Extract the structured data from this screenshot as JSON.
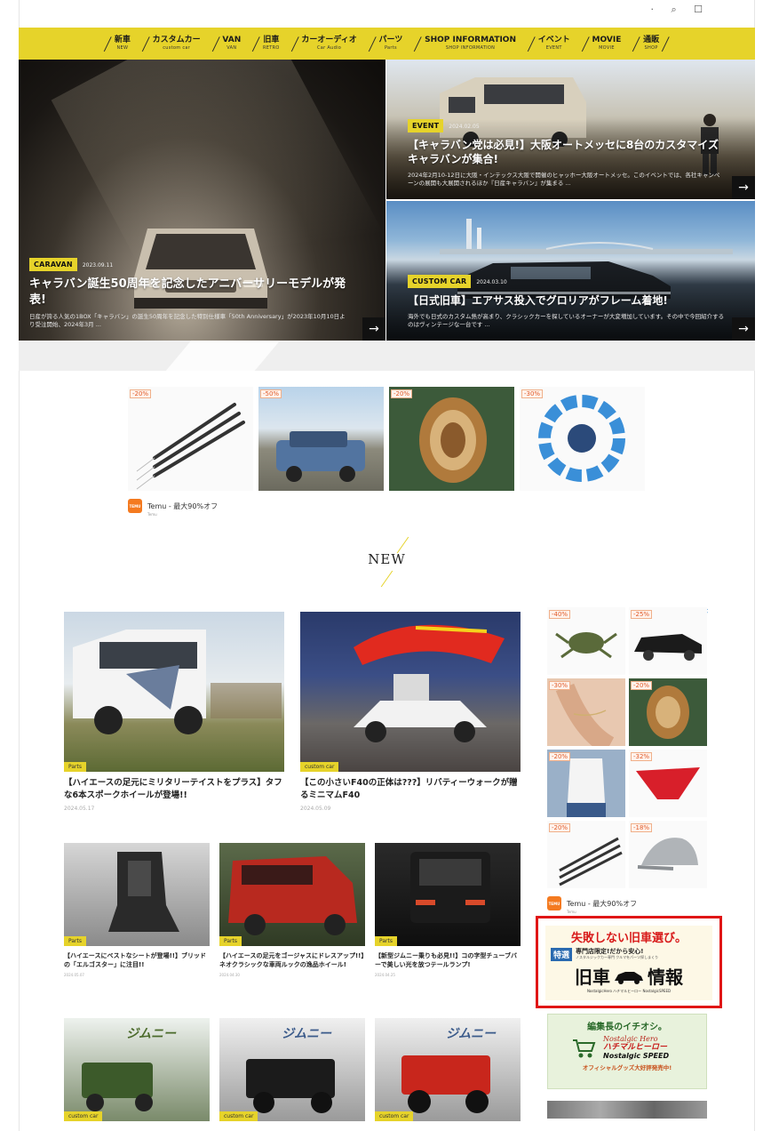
{
  "nav": {
    "items": [
      {
        "label": "新車",
        "sub": "NEW"
      },
      {
        "label": "カスタムカー",
        "sub": "custom car"
      },
      {
        "label": "VAN",
        "sub": "VAN"
      },
      {
        "label": "旧車",
        "sub": "RETRO"
      },
      {
        "label": "カーオーディオ",
        "sub": "Car Audio"
      },
      {
        "label": "パーツ",
        "sub": "Parts"
      },
      {
        "label": "SHOP INFORMATION",
        "sub": "SHOP INFORMATION"
      },
      {
        "label": "イベント",
        "sub": "EVENT"
      },
      {
        "label": "MOVIE",
        "sub": "MOVIE"
      },
      {
        "label": "通販",
        "sub": "SHOP"
      }
    ]
  },
  "hero": {
    "main": {
      "badge": "CARAVAN",
      "date": "2023.09.11",
      "title": "キャラバン誕生50周年を記念したアニバーサリーモデルが発表!",
      "desc": "日産が誇る人気の1BOX「キャラバン」の誕生50周年を記念した特別仕様車「50th Anniversary」が2023年10月10日より受注開始、2024年3月 ..."
    },
    "sub1": {
      "badge": "EVENT",
      "date": "2024.02.05",
      "title": "【キャラバン党は必見!】大阪オートメッセに8台のカスタマイズキャラバンが集合!",
      "desc": "2024年2月10-12日に大阪・インテックス大阪で開催のヒャッホー大阪オートメッセ。このイベントでは、各社キャンペーンの展開も大展開されるほか『日産キャラバン』が集まる ..."
    },
    "sub2": {
      "badge": "CUSTOM CAR",
      "date": "2024.03.10",
      "title": "【日式旧車】エアサス投入でグロリアがフレーム着地!",
      "desc": "海外でも日式のカスタム熱が高まり、クラシックカーを探しているオーナーが大変増加しています。その中で今回紹介するのはヴィンテージな一台です ..."
    },
    "arrow": "→"
  },
  "ad_top": {
    "tiles": [
      {
        "discount": "-20%",
        "kind": "darts"
      },
      {
        "discount": "-50%",
        "kind": "suv"
      },
      {
        "discount": "-20%",
        "kind": "agate"
      },
      {
        "discount": "-30%",
        "kind": "spinner"
      }
    ],
    "brand": "Temu - 最大90%オフ",
    "brand_sub": "Temu",
    "logo_text": "TEMU"
  },
  "section": {
    "title": "NEW"
  },
  "articles": {
    "big": [
      {
        "category": "Parts",
        "title": "【ハイエースの足元にミリタリーテイストをプラス】タフな6本スポークホイールが登場!!",
        "date": "2024.05.17"
      },
      {
        "category": "custom car",
        "title": "【この小さいF40の正体は???】リバティーウォークが贈るミニマムF40",
        "date": "2024.05.09"
      }
    ],
    "small": [
      {
        "category": "Parts",
        "title": "【ハイエースにベストなシートが登場!!】ブリッドの「エルゴスター」に注目!!",
        "date": "2024.05.07"
      },
      {
        "category": "Parts",
        "title": "【ハイエースの足元をゴージャスにドレスアップ!!】ネオクラシックな車両ルックの逸品ホイール!",
        "date": "2024.04.30"
      },
      {
        "category": "Parts",
        "title": "【新型ジムニー乗りも必見!!】コの字型チューブバーで美しい光を放つテールランプ!",
        "date": "2024.04.25"
      }
    ],
    "bottom": [
      {
        "category": "custom car"
      },
      {
        "category": "custom car"
      },
      {
        "category": "custom car"
      }
    ],
    "jimny_label": "ジムニー"
  },
  "sidebar": {
    "ad_tiles": [
      {
        "discount": "-40%",
        "kind": "crab"
      },
      {
        "discount": "-25%",
        "kind": "car"
      },
      {
        "discount": "-30%",
        "kind": "anklet"
      },
      {
        "discount": "-20%",
        "kind": "agate"
      },
      {
        "discount": "-20%",
        "kind": "top"
      },
      {
        "discount": "-32%",
        "kind": "brief"
      },
      {
        "discount": "-20%",
        "kind": "darts"
      },
      {
        "discount": "-18%",
        "kind": "cap"
      }
    ],
    "brand": "Temu - 最大90%オフ",
    "brand_sub": "Temu",
    "logo_text": "TEMU",
    "promo_red": {
      "headline": "失敗しない旧車選び。",
      "tag": "特選",
      "sub1": "専門店限定!だから安心!",
      "sub2": "ノスタルジックカー専門 クルマをパーツ探しまくり",
      "big": "旧車",
      "big2": "情報",
      "footer": "NostalgicHero ハチマルヒーロー NostalgicSPEED"
    },
    "promo_green": {
      "headline": "編集長のイチオシ。",
      "brand1": "Nostalgic Hero",
      "brand2": "ハチマルヒーロー",
      "brand3": "Nostalgic SPEED",
      "footer": "オフィシャルグッズ大好評発売中!"
    }
  },
  "colors": {
    "accent": "#e6d32a",
    "promo_red": "#e01616",
    "dark": "#111111"
  }
}
